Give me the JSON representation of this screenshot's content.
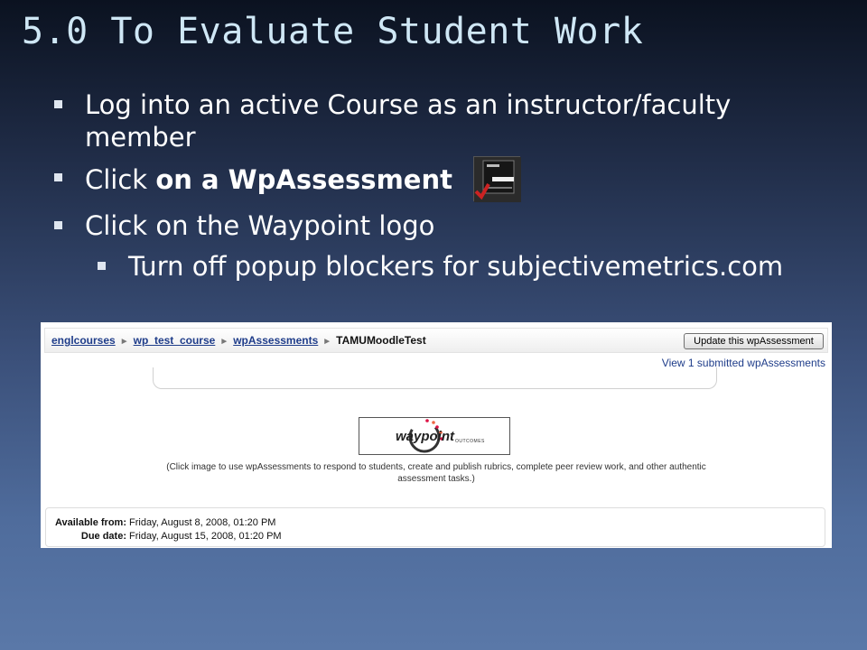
{
  "slide": {
    "title": "5.0 To Evaluate Student Work",
    "bullets": {
      "b1": "Log into an active Course as an instructor/faculty member",
      "b2_plain": "Click ",
      "b2_bold": "on a WpAssessment",
      "b3": "Click on the Waypoint logo",
      "b3_sub": "Turn off popup blockers for subjectivemetrics.com"
    },
    "icon": "wpassessment-icon"
  },
  "screenshot": {
    "breadcrumb": [
      "englcourses",
      "wp_test_course",
      "wpAssessments"
    ],
    "breadcrumb_current": "TAMUMoodleTest",
    "breadcrumb_separator": "►",
    "update_button": "Update this wpAssessment",
    "view_link": "View 1 submitted wpAssessments",
    "logo": {
      "main": "waypoint",
      "sub": "OUTCOMES"
    },
    "caption": "(Click image to use wpAssessments to respond to students, create and publish rubrics, complete peer review work, and other authentic assessment tasks.)",
    "available_label": "Available from:",
    "available_value": "Friday, August 8, 2008, 01:20 PM",
    "due_label": "Due date:",
    "due_value": "Friday, August 15, 2008, 01:20 PM"
  }
}
